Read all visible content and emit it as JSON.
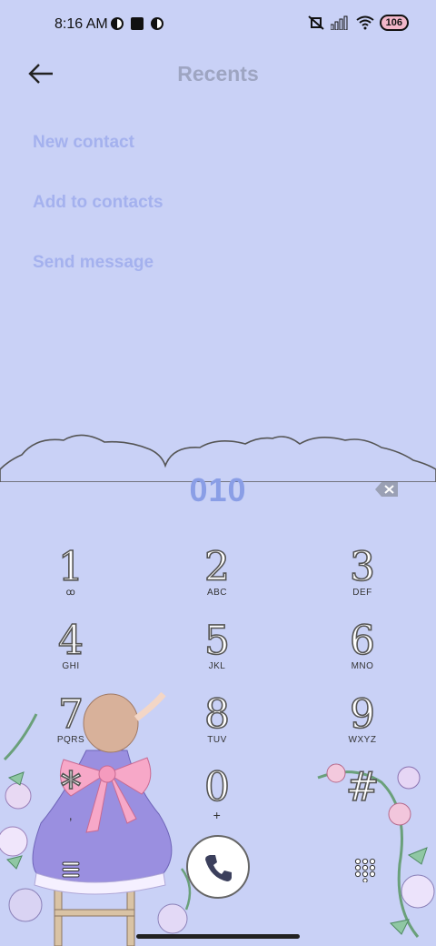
{
  "status_bar": {
    "time": "8:16 AM",
    "battery": "106"
  },
  "header": {
    "title": "Recents",
    "back_icon": "arrow-left-icon"
  },
  "menu": {
    "items": [
      {
        "label": "New contact"
      },
      {
        "label": "Add to contacts"
      },
      {
        "label": "Send message"
      }
    ]
  },
  "dialer": {
    "entered_number": "010",
    "keys": [
      {
        "digit": "1",
        "letters": "ꝏ"
      },
      {
        "digit": "2",
        "letters": "ABC"
      },
      {
        "digit": "3",
        "letters": "DEF"
      },
      {
        "digit": "4",
        "letters": "GHI"
      },
      {
        "digit": "5",
        "letters": "JKL"
      },
      {
        "digit": "6",
        "letters": "MNO"
      },
      {
        "digit": "7",
        "letters": "PQRS"
      },
      {
        "digit": "8",
        "letters": "TUV"
      },
      {
        "digit": "9",
        "letters": "WXYZ"
      },
      {
        "digit": "*",
        "letters": ","
      },
      {
        "digit": "0",
        "letters": "+"
      },
      {
        "digit": "#",
        "letters": ""
      }
    ]
  },
  "colors": {
    "background": "#c9d1f6",
    "menu_text": "#a4b1ee",
    "number_text": "#8a9ee6"
  }
}
